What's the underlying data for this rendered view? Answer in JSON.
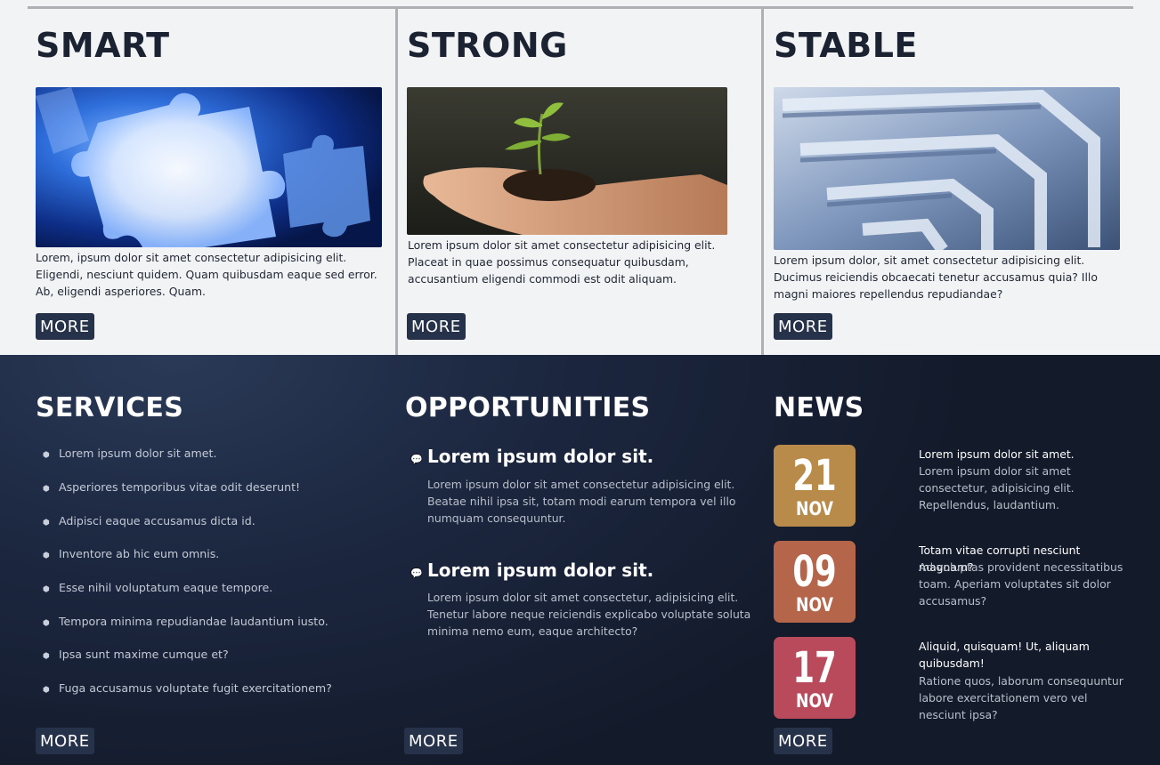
{
  "features": [
    {
      "title": "SMART",
      "image_icon": "puzzle-image",
      "text": "Lorem, ipsum dolor sit amet consectetur adipisicing elit. Eligendi, nesciunt quidem. Quam quibusdam eaque sed error. Ab, eligendi asperiores. Quam.",
      "more": "MORE"
    },
    {
      "title": "STRONG",
      "image_icon": "seedling-hand-image",
      "text": "Lorem ipsum dolor sit amet consectetur adipisicing elit. Placeat in quae possimus consequatur quibusdam, accusantium eligendi commodi est odit aliquam.",
      "more": "MORE"
    },
    {
      "title": "STABLE",
      "image_icon": "maze-image",
      "text": "Lorem ipsum dolor, sit amet consectetur adipisicing elit. Ducimus reiciendis obcaecati tenetur accusamus quia? Illo magni maiores repellendus repudiandae?",
      "more": "MORE"
    }
  ],
  "services": {
    "title": "SERVICES",
    "items": [
      "Lorem ipsum dolor sit amet.",
      "Asperiores temporibus vitae odit deserunt!",
      "Adipisci eaque accusamus dicta id.",
      "Inventore ab hic eum omnis.",
      "Esse nihil voluptatum eaque tempore.",
      "Tempora minima repudiandae laudantium iusto.",
      "Ipsa sunt maxime cumque et?",
      "Fuga accusamus voluptate fugit exercitationem?"
    ],
    "more": "MORE"
  },
  "opportunities": {
    "title": "OPPORTUNITIES",
    "items": [
      {
        "heading": "Lorem ipsum dolor sit.",
        "text": "Lorem ipsum dolor sit amet consectetur adipisicing elit. Beatae nihil ipsa sit, totam modi earum tempora vel illo numquam consequuntur."
      },
      {
        "heading": "Lorem ipsum dolor sit.",
        "text": "Lorem ipsum dolor sit amet consectetur, adipisicing elit. Tenetur labore neque reiciendis explicabo voluptate soluta minima nemo eum, eaque architecto?"
      }
    ],
    "more": "MORE"
  },
  "news": {
    "title": "NEWS",
    "items": [
      {
        "day": "21",
        "month": "NOV",
        "color": "#b88b4a",
        "headline": "Lorem ipsum dolor sit amet.",
        "body": "Lorem ipsum dolor sit amet consectetur, adipisicing elit. Repellendus, laudantium."
      },
      {
        "day": "09",
        "month": "NOV",
        "color": "#b4654a",
        "headline": "Totam vitae corrupti nesciunt magnam?",
        "body": "Ad voluptas provident necessitatibus toam. Aperiam voluptates sit dolor accusamus?"
      },
      {
        "day": "17",
        "month": "NOV",
        "color": "#b84a5c",
        "headline": "Aliquid, quisquam! Ut, aliquam quibusdam!",
        "body": "Ratione quos, laborum consequuntur labore exercitationem vero vel nesciunt ipsa?"
      }
    ],
    "more": "MORE"
  },
  "colors": {
    "panel_top": "#f2f3f5",
    "panel_dark": "#1c2740",
    "button": "#26324a",
    "divider": "#aeb0b4"
  }
}
